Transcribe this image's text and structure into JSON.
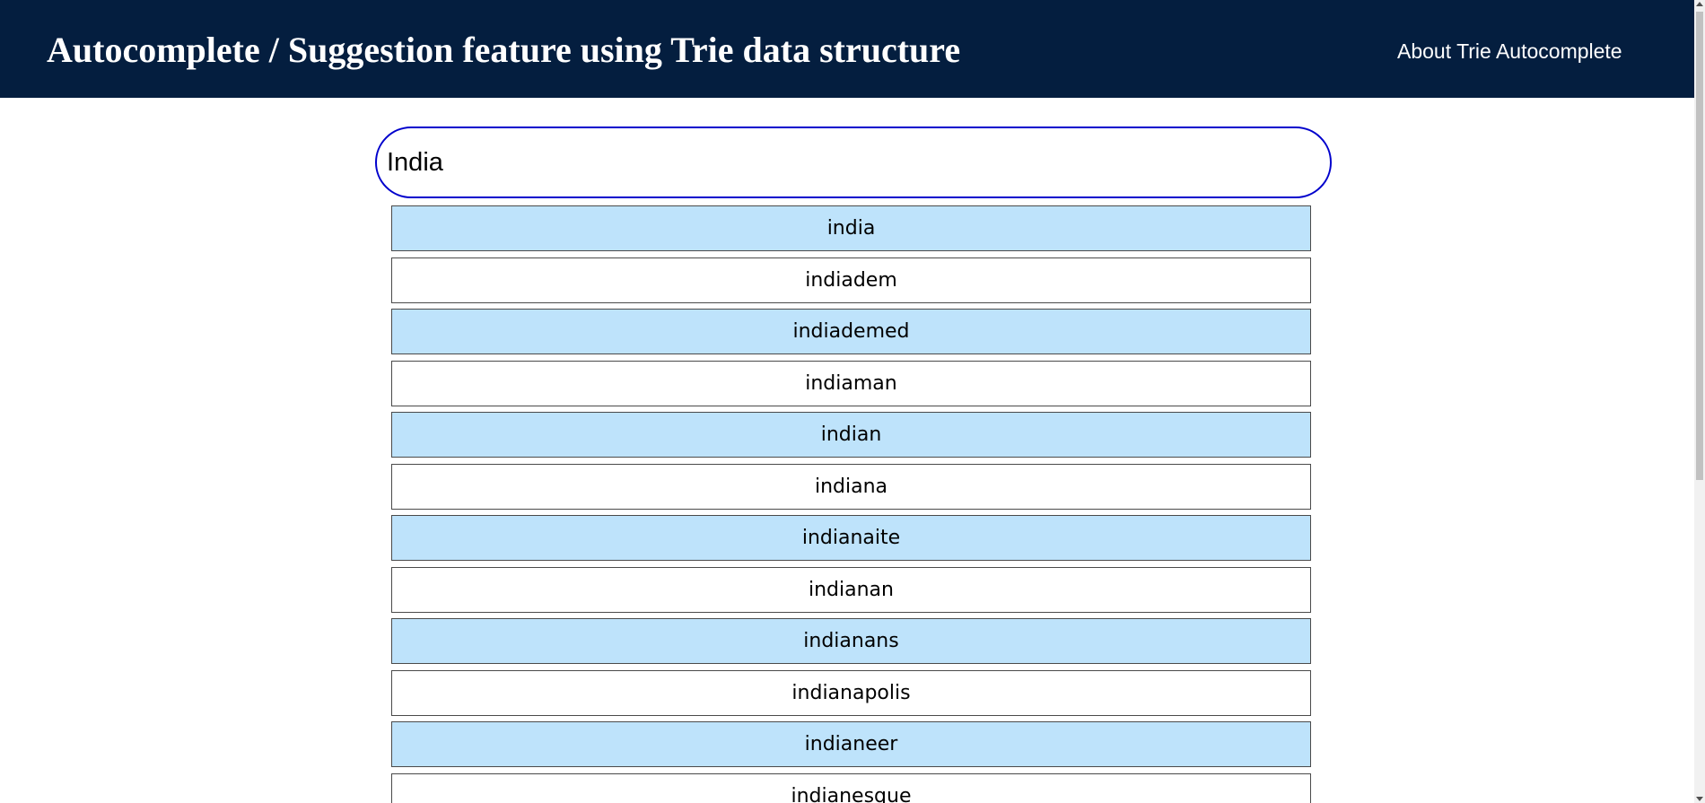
{
  "header": {
    "title": "Autocomplete / Suggestion feature using Trie data structure",
    "about_link": "About Trie Autocomplete"
  },
  "search": {
    "value": "India",
    "placeholder": ""
  },
  "suggestions": [
    "india",
    "indiadem",
    "indiademed",
    "indiaman",
    "indian",
    "indiana",
    "indianaite",
    "indianan",
    "indianans",
    "indianapolis",
    "indianeer",
    "indianesque"
  ],
  "colors": {
    "header_background": "#041e3f",
    "header_text": "#ffffff",
    "search_border": "#0000cc",
    "suggestion_highlight": "#bee3fb",
    "suggestion_plain": "#ffffff"
  }
}
